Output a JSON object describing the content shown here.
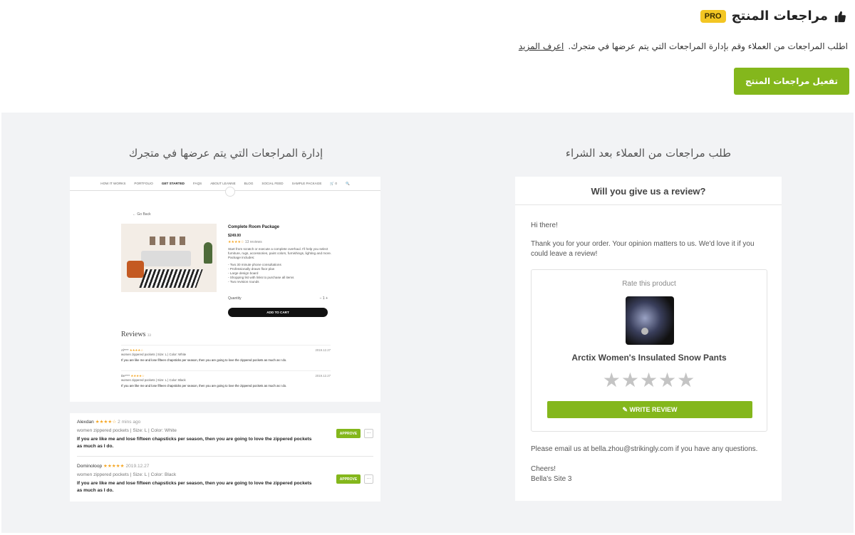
{
  "header": {
    "title": "مراجعات المنتج",
    "badge": "PRO",
    "description": "اطلب المراجعات من العملاء وقم بإدارة المراجعات التي يتم عرضها في متجرك.",
    "learn_more": "اعرف المزيد",
    "activate_label": "تفعيل مراجعات المنتج"
  },
  "left": {
    "title": "إدارة المراجعات التي يتم عرضها في متجرك",
    "site_nav": [
      "HOW IT WORKS",
      "PORTFOLIO",
      "GET STARTED",
      "FAQS",
      "ABOUT LEANNE",
      "BLOG",
      "SOCIAL FEED",
      "SAMPLE PACKAGE",
      "🛒 0",
      "🔍"
    ],
    "go_back": "← Go Back",
    "product": {
      "name": "Complete Room Package",
      "price": "$249.00",
      "stars": "★★★★☆",
      "review_count": "13 reviews",
      "description": "Start from scratch or execute a complete overhaul. I'll help you select furniture, rugs, accessories, paint colors, furnishings, lighting and more. Package includes:",
      "list": [
        "- Two 30 minute phone consultations",
        "- Professionally drawn floor plan",
        "- Large design board",
        "- Shopping list with links to purchase all items",
        "- Two revision rounds"
      ],
      "quantity_label": "Quantity",
      "quantity_value": "−   1   +",
      "add_to_cart": "ADD TO CART"
    },
    "reviews_heading": "Reviews",
    "reviews_count": "33",
    "site_reviews": [
      {
        "name": "Al****",
        "stars": "★★★★☆",
        "date": "2019.12.27",
        "meta": "women zippered pockets  |  Size: L  |  Color: White",
        "text": "If you are like me and lose fifteen chapsticks per season, then you are going to love the zippered pockets as much as I do."
      },
      {
        "name": "De****",
        "stars": "★★★★☆",
        "date": "2019.12.27",
        "meta": "women zippered pockets  |  Size: L  |  Color: Black",
        "text": "If you are like me and lose fifteen chapsticks per season, then you are going to love the zippered pockets as much as I do."
      }
    ],
    "admin_reviews": [
      {
        "name": "Alexdan",
        "stars": "★★★★☆",
        "date": "2 mins ago",
        "meta": "women zippered pockets  |  Size: L  |  Color: White",
        "text": "If you are like me and lose fifteen chapsticks per season, then you are going to love the zippered pockets as much as I do.",
        "approve": "APPROVE",
        "more": "···"
      },
      {
        "name": "Dominoloop",
        "stars": "★★★★★",
        "date": "2019.12.27",
        "meta": "women zippered pockets  |  Size: L  |  Color: Black",
        "text": "If you are like me and lose fifteen chapsticks per season, then you are going to love the zippered pockets as much as I do.",
        "approve": "APPROVE",
        "more": "···"
      }
    ]
  },
  "right": {
    "title": "طلب مراجعات من العملاء بعد الشراء",
    "email_heading": "Will you give us a review?",
    "greeting": "Hi there!",
    "body": "Thank you for your order. Your opinion matters to us. We'd love it if you could leave a review!",
    "rate_label": "Rate this product",
    "product_name": "Arctix Women's Insulated Snow Pants",
    "stars": "★★★★★",
    "write_review": "✎  WRITE REVIEW",
    "contact": "Please email us at bella.zhou@strikingly.com if you have any questions.",
    "signoff": "Cheers!",
    "site_name": "Bella's Site 3"
  },
  "colors": {
    "accent": "#84b71c",
    "badge": "#f3c623",
    "panel_bg": "#f2f3f5",
    "star": "#f5a623"
  }
}
